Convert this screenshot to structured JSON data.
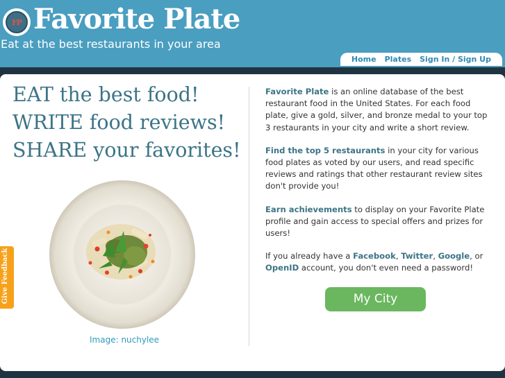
{
  "brand": {
    "logo_text": "FP",
    "title": "Favorite Plate",
    "tagline": "Eat at the best restaurants in your area"
  },
  "nav": {
    "items": [
      "Home",
      "Plates",
      "Sign In / Sign Up"
    ]
  },
  "hero": {
    "line1": "EAT the best food!",
    "line2": "WRITE food reviews!",
    "line3": "SHARE your favorites!",
    "image_credit_prefix": "Image: ",
    "image_credit_name": "nuchylee"
  },
  "intro": {
    "p1_strong": "Favorite Plate",
    "p1_rest": " is an online database of the best restaurant food in the United States. For each food plate, give a gold, silver, and bronze medal to your top 3 restaurants in your city and write a short review.",
    "p2_strong": "Find the top 5 restaurants",
    "p2_rest": " in your city for various food plates as voted by our users, and read specific reviews and ratings that other restaurant review sites don't provide you!",
    "p3_strong": "Earn achievements",
    "p3_rest": " to display on your Favorite Plate profile and gain access to special offers and prizes for users!",
    "p4_a": "If you already have a ",
    "p4_facebook": "Facebook",
    "p4_comma1": ", ",
    "p4_twitter": "Twitter",
    "p4_comma2": ", ",
    "p4_google": "Google",
    "p4_or": ", or ",
    "p4_openid": "OpenID",
    "p4_end": " account, you don't even need a password!"
  },
  "cta": {
    "label": "My City"
  },
  "feedback": {
    "label": "Give Feedback"
  },
  "colors": {
    "header_bg": "#4a9ec0",
    "page_bg": "#1f3440",
    "accent_teal": "#3c7486",
    "link_blue": "#2f89b4",
    "cta_green": "#6ab760",
    "feedback_orange": "#f7a11a"
  }
}
